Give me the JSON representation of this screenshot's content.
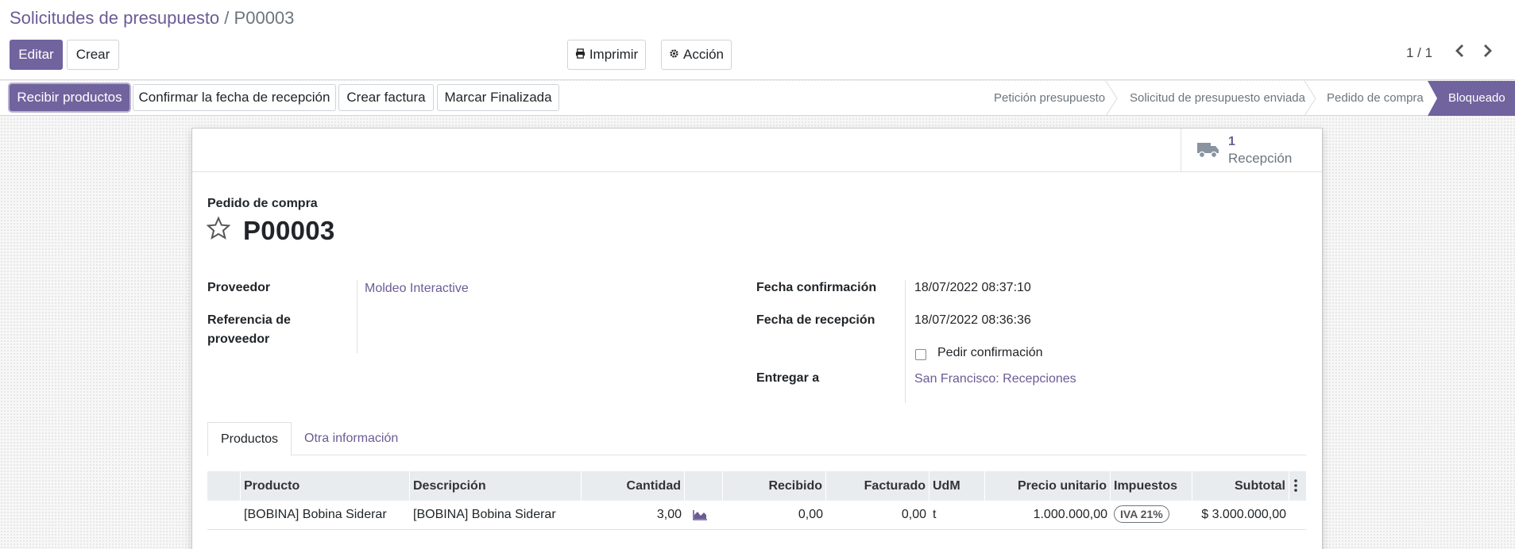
{
  "breadcrumb": {
    "parent": "Solicitudes de presupuesto",
    "separator": "/",
    "current": "P00003"
  },
  "toolbar": {
    "edit_label": "Editar",
    "create_label": "Crear",
    "print_label": "Imprimir",
    "action_label": "Acción",
    "print_icon": "printer-icon",
    "action_icon": "gear-icon"
  },
  "pager": {
    "value": "1 / 1"
  },
  "statusbar": {
    "buttons": {
      "receive": "Recibir productos",
      "confirm_date": "Confirmar la fecha de recepción",
      "create_invoice": "Crear factura",
      "mark_done": "Marcar Finalizada"
    },
    "stages": [
      "Petición presupuesto",
      "Solicitud de presupuesto enviada",
      "Pedido de compra",
      "Bloqueado"
    ],
    "active_stage": "Bloqueado"
  },
  "smart_button": {
    "icon": "truck-icon",
    "count": "1",
    "label": "Recepción"
  },
  "record": {
    "type_label": "Pedido de compra",
    "name": "P00003"
  },
  "fields": {
    "vendor_label": "Proveedor",
    "vendor_value": "Moldeo Interactive",
    "vendor_ref_label_1": "Referencia de",
    "vendor_ref_label_2": "proveedor",
    "confirm_date_label": "Fecha confirmación",
    "confirm_date_value": "18/07/2022 08:37:10",
    "receipt_date_label": "Fecha de recepción",
    "receipt_date_value": "18/07/2022 08:36:36",
    "ask_confirmation_label": "Pedir confirmación",
    "ask_confirmation_checked": false,
    "deliver_to_label": "Entregar a",
    "deliver_to_value": "San Francisco: Recepciones"
  },
  "tabs": [
    {
      "label": "Productos",
      "active": true
    },
    {
      "label": "Otra información",
      "active": false
    }
  ],
  "table": {
    "headers": {
      "product": "Producto",
      "description": "Descripción",
      "quantity": "Cantidad",
      "received": "Recibido",
      "invoiced": "Facturado",
      "uom": "UdM",
      "unit_price": "Precio unitario",
      "taxes": "Impuestos",
      "subtotal": "Subtotal"
    },
    "rows": [
      {
        "product": "[BOBINA] Bobina Siderar",
        "description": "[BOBINA] Bobina Siderar",
        "quantity": "3,00",
        "forecast_icon": "area-chart-icon",
        "received": "0,00",
        "invoiced": "0,00",
        "uom": "t",
        "unit_price": "1.000.000,00",
        "tax": "IVA 21%",
        "subtotal": "$ 3.000.000,00"
      }
    ]
  },
  "colors": {
    "primary": "#71639e",
    "link": "#6b5b95"
  }
}
